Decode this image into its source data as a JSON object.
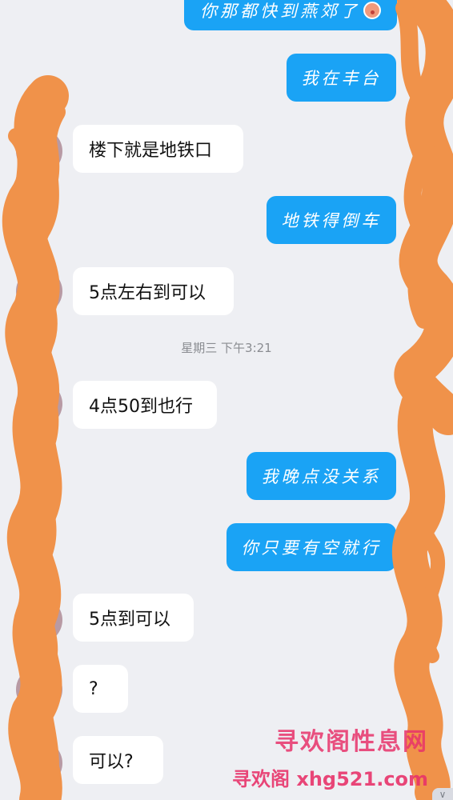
{
  "conversation": {
    "timestamp": "星期三 下午3:21",
    "messages": [
      {
        "side": "out",
        "text": "你那都快到燕郊了"
      },
      {
        "side": "out",
        "text": "我在丰台"
      },
      {
        "side": "in",
        "text": "楼下就是地铁口"
      },
      {
        "side": "out",
        "text": "地铁得倒车"
      },
      {
        "side": "in",
        "text": "5点左右到可以"
      },
      {
        "side": "in",
        "text": "4点50到也行"
      },
      {
        "side": "out",
        "text": "我晚点没关系"
      },
      {
        "side": "out",
        "text": "你只要有空就行"
      },
      {
        "side": "in",
        "text": "5点到可以"
      },
      {
        "side": "in",
        "text": "?"
      },
      {
        "side": "in",
        "text": "可以?"
      }
    ]
  },
  "watermark": {
    "line1": "寻欢阁性息网",
    "line2": "寻欢阁 xhg521.com"
  },
  "colors": {
    "background": "#EEEFF3",
    "outgoing_bubble": "#1AA3F5",
    "incoming_bubble": "#FFFFFF",
    "redaction": "#F0924A",
    "watermark": "#E8336A"
  },
  "icons": [
    "emoji-icon",
    "chevron-down-icon"
  ]
}
